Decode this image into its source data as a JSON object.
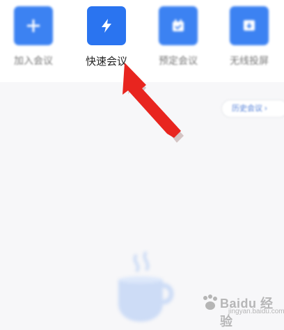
{
  "actions": [
    {
      "label": "加入会议",
      "icon": "plus-icon"
    },
    {
      "label": "快速会议",
      "icon": "lightning-icon"
    },
    {
      "label": "预定会议",
      "icon": "calendar-icon"
    },
    {
      "label": "无线投屏",
      "icon": "screen-cast-icon"
    }
  ],
  "history_button": {
    "label": "历史会议 ›"
  },
  "illustration": {
    "icon": "coffee-cup-icon"
  },
  "annotation": {
    "icon": "red-arrow-icon",
    "color": "#e8251f"
  },
  "watermark": {
    "text": "Baidu 经验",
    "sub": "jingyan.baidu.com"
  },
  "colors": {
    "accent": "#2a74f0",
    "background": "#f7f7f9",
    "panel": "#ffffff"
  }
}
